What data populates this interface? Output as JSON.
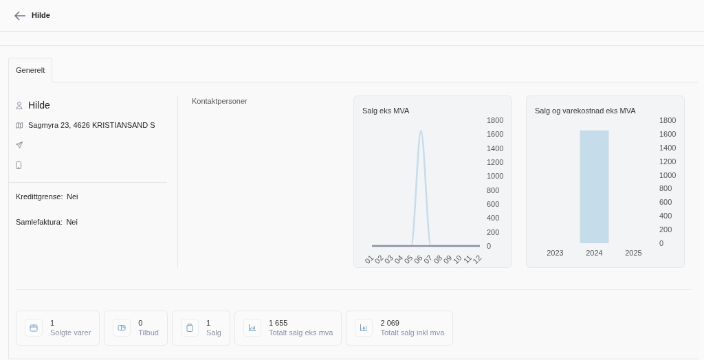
{
  "header": {
    "title": "Hilde"
  },
  "tabs": [
    {
      "label": "Generelt",
      "selected": true
    }
  ],
  "customer": {
    "name": "Hilde",
    "address": "Sagmyra 23, 4626 KRISTIANSAND S"
  },
  "fields": [
    {
      "label": "Kredittgrense:",
      "value": "Nei"
    },
    {
      "label": "Samlefaktura:",
      "value": "Nei"
    }
  ],
  "contacts": {
    "title": "Kontaktpersoner"
  },
  "charts": [
    {
      "chart_data": {
        "type": "line",
        "title": "Salg eks MVA",
        "categories": [
          "01",
          "02",
          "03",
          "04",
          "05",
          "06",
          "07",
          "08",
          "09",
          "10",
          "11",
          "12"
        ],
        "series": [
          {
            "color": "#c5dcea",
            "values": [
              0,
              0,
              0,
              0,
              0,
              1650,
              0,
              0,
              0,
              0,
              0,
              0
            ]
          },
          {
            "color": "#8a93a6",
            "values": [
              0,
              0,
              0,
              0,
              0,
              0,
              0,
              0,
              0,
              0,
              0,
              0
            ]
          }
        ],
        "ylim": [
          0,
          1800
        ],
        "yticks": [
          0,
          200,
          400,
          600,
          800,
          1000,
          1200,
          1400,
          1600,
          1800
        ]
      }
    },
    {
      "chart_data": {
        "type": "bar",
        "title": "Salg og varekostnad eks MVA",
        "categories": [
          "2023",
          "2024",
          "2025"
        ],
        "series": [
          {
            "color": "#c5dcea",
            "values": [
              0,
              1650,
              0
            ]
          }
        ],
        "ylim": [
          0,
          1800
        ],
        "yticks": [
          0,
          200,
          400,
          600,
          800,
          1000,
          1200,
          1400,
          1600,
          1800
        ]
      }
    }
  ],
  "stats": [
    {
      "value": "1",
      "label": "Solgte varer"
    },
    {
      "value": "0",
      "label": "Tilbud"
    },
    {
      "value": "1",
      "label": "Salg"
    },
    {
      "value": "1 655",
      "label": "Totalt salg eks mva"
    },
    {
      "value": "2 069",
      "label": "Totalt salg inkl mva"
    }
  ]
}
